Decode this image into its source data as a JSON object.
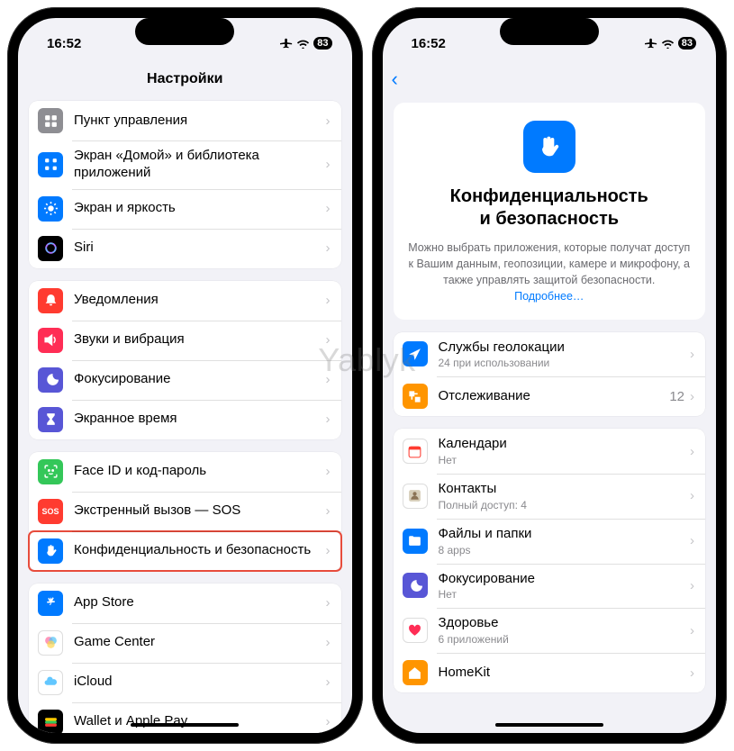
{
  "watermark": "Yablyk",
  "statusbar": {
    "time": "16:52",
    "battery": "83"
  },
  "left": {
    "title": "Настройки",
    "g1": [
      {
        "label": "Пункт управления"
      },
      {
        "label": "Экран «Домой» и библиотека приложений"
      },
      {
        "label": "Экран и яркость"
      },
      {
        "label": "Siri"
      }
    ],
    "g2": [
      {
        "label": "Уведомления"
      },
      {
        "label": "Звуки и вибрация"
      },
      {
        "label": "Фокусирование"
      },
      {
        "label": "Экранное время"
      }
    ],
    "g3": [
      {
        "label": "Face ID и код-пароль"
      },
      {
        "label": "Экстренный вызов — SOS"
      },
      {
        "label": "Конфиденциальность и безопасность"
      }
    ],
    "g4": [
      {
        "label": "App Store"
      },
      {
        "label": "Game Center"
      },
      {
        "label": "iCloud"
      },
      {
        "label": "Wallet и Apple Pay"
      }
    ]
  },
  "right": {
    "hero_title1": "Конфиденциальность",
    "hero_title2": "и безопасность",
    "hero_desc": "Можно выбрать приложения, которые получат доступ к Вашим данным, геопозиции, камере и микрофону, а также управлять защитой безопасности.",
    "hero_link": "Подробнее…",
    "g1": [
      {
        "label": "Службы геолокации",
        "sub": "24 при использовании"
      },
      {
        "label": "Отслеживание",
        "value": "12"
      }
    ],
    "g2": [
      {
        "label": "Календари",
        "sub": "Нет"
      },
      {
        "label": "Контакты",
        "sub": "Полный доступ: 4"
      },
      {
        "label": "Файлы и папки",
        "sub": "8 apps"
      },
      {
        "label": "Фокусирование",
        "sub": "Нет"
      },
      {
        "label": "Здоровье",
        "sub": "6 приложений"
      },
      {
        "label": "HomeKit"
      }
    ]
  }
}
